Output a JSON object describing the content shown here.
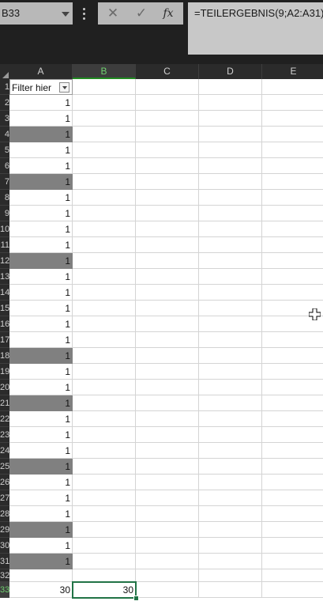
{
  "formula_bar": {
    "name_box": "B33",
    "cancel_icon": "x-icon",
    "enter_icon": "check-icon",
    "fx_label": "fx",
    "formula": "=TEILERGEBNIS(9;A2:A31)"
  },
  "columns": [
    "A",
    "B",
    "C",
    "D",
    "E"
  ],
  "selected_column": "B",
  "rows": [
    {
      "num": "1",
      "a": "Filter hier",
      "shade": false
    },
    {
      "num": "2",
      "a": "1",
      "shade": false
    },
    {
      "num": "3",
      "a": "1",
      "shade": false
    },
    {
      "num": "4",
      "a": "1",
      "shade": true
    },
    {
      "num": "5",
      "a": "1",
      "shade": false
    },
    {
      "num": "6",
      "a": "1",
      "shade": false
    },
    {
      "num": "7",
      "a": "1",
      "shade": true
    },
    {
      "num": "8",
      "a": "1",
      "shade": false
    },
    {
      "num": "9",
      "a": "1",
      "shade": false
    },
    {
      "num": "10",
      "a": "1",
      "shade": false
    },
    {
      "num": "11",
      "a": "1",
      "shade": false
    },
    {
      "num": "12",
      "a": "1",
      "shade": true
    },
    {
      "num": "13",
      "a": "1",
      "shade": false
    },
    {
      "num": "14",
      "a": "1",
      "shade": false
    },
    {
      "num": "15",
      "a": "1",
      "shade": false
    },
    {
      "num": "16",
      "a": "1",
      "shade": false
    },
    {
      "num": "17",
      "a": "1",
      "shade": false
    },
    {
      "num": "18",
      "a": "1",
      "shade": true
    },
    {
      "num": "19",
      "a": "1",
      "shade": false
    },
    {
      "num": "20",
      "a": "1",
      "shade": false
    },
    {
      "num": "21",
      "a": "1",
      "shade": true
    },
    {
      "num": "22",
      "a": "1",
      "shade": false
    },
    {
      "num": "23",
      "a": "1",
      "shade": false
    },
    {
      "num": "24",
      "a": "1",
      "shade": false
    },
    {
      "num": "25",
      "a": "1",
      "shade": true
    },
    {
      "num": "26",
      "a": "1",
      "shade": false
    },
    {
      "num": "27",
      "a": "1",
      "shade": false
    },
    {
      "num": "28",
      "a": "1",
      "shade": false
    },
    {
      "num": "29",
      "a": "1",
      "shade": true
    },
    {
      "num": "30",
      "a": "1",
      "shade": false
    },
    {
      "num": "31",
      "a": "1",
      "shade": true
    },
    {
      "num": "32",
      "a": "",
      "shade": false
    },
    {
      "num": "33",
      "a": "30",
      "b": "30",
      "shade": false
    }
  ],
  "selected_row": "33",
  "colors": {
    "shade": "#808080",
    "accent": "#217346",
    "header_bg": "#2b2b2b"
  }
}
